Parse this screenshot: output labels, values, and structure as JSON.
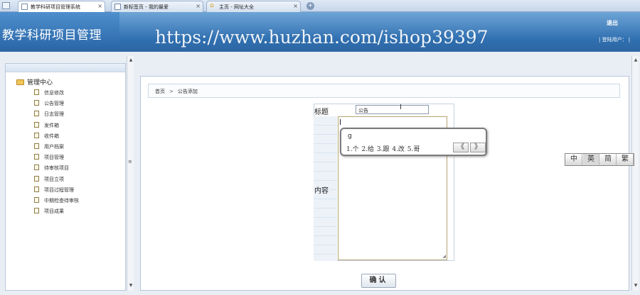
{
  "browser": {
    "tabs": [
      {
        "label": "教学科研项目管理系统",
        "active": true,
        "icon": "page-icon"
      },
      {
        "label": "新标签页 - 我的最爱",
        "active": false,
        "icon": "page-icon"
      },
      {
        "label": "主页 - 网址大全",
        "active": false,
        "icon": "home-icon"
      }
    ],
    "new_tab_glyph": "+"
  },
  "header": {
    "app_title": "教学科研项目管理",
    "watermark": "https://www.huzhan.com/ishop39397",
    "logout": "退出",
    "user_line": "| 登陆用户： |",
    "colors": {
      "banner": "#2f6fb0",
      "banner_light": "#6fa5d7"
    }
  },
  "sidebar": {
    "root_label": "管理中心",
    "items": [
      "信息修改",
      "公告管理",
      "日志管理",
      "发件箱",
      "收件箱",
      "用户档案",
      "项目管理",
      "待审核项目",
      "项目立项",
      "项目过程管理",
      "中期检查待审核",
      "项目成果"
    ],
    "splitter_glyph": "≡"
  },
  "breadcrumb": {
    "home": "首页",
    "separator": ">",
    "current": "公告添加"
  },
  "form": {
    "title_label": "标题",
    "title_value": "公告",
    "content_label": "内容",
    "submit_label": "确认"
  },
  "ime": {
    "composition": "g",
    "candidates": "1.个 2.给 3.跟 4.改 5.哥",
    "prev_page": "《",
    "next_page": "》",
    "status_items": [
      "中",
      "英",
      "简",
      "繁"
    ]
  }
}
